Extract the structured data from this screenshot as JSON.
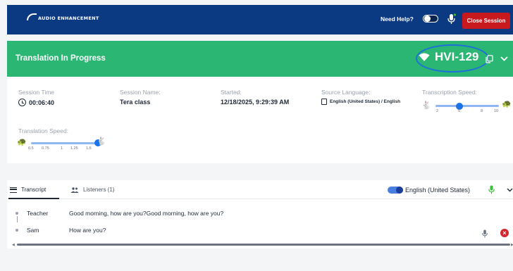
{
  "header": {
    "logo_text": "AUDIO ENHANCEMENT",
    "need_help": "Need Help?",
    "close_session": "Close Session"
  },
  "banner": {
    "title": "Translation In Progress",
    "session_code": "HVI-129"
  },
  "info": {
    "session_time": {
      "label": "Session Time",
      "value": "00:06:40"
    },
    "session_name": {
      "label": "Session Name:",
      "value": "Tera class"
    },
    "started": {
      "label": "Started:",
      "value": "12/18/2025, 9:29:39 AM"
    },
    "source_language": {
      "label": "Source Language:",
      "value": "English (United States) / English"
    },
    "transcription_speed": {
      "label": "Transcription Speed:",
      "ticks": [
        "2",
        "5",
        "8",
        "10"
      ],
      "value": 5
    },
    "translation_speed": {
      "label": "Translation Speed:",
      "ticks": [
        "0.5",
        "0.75",
        "1",
        "1.25",
        "1.5"
      ],
      "value": 1.5
    }
  },
  "transcript_panel": {
    "tabs": [
      {
        "label": "Transcript",
        "active": true
      },
      {
        "label": "Listeners (1)",
        "active": false
      }
    ],
    "language": "English (United States)",
    "rows": [
      {
        "speaker": "Teacher",
        "text": "Good morning, how are you?Good morning, how are you?"
      },
      {
        "speaker": "Sam",
        "text": "How are you?"
      }
    ]
  },
  "colors": {
    "header_bg": "#0b3a82",
    "banner_bg": "#2bb673",
    "close_button": "#c8191e",
    "slider": "#1a73e8",
    "mic_green": "#3dbb3d"
  }
}
